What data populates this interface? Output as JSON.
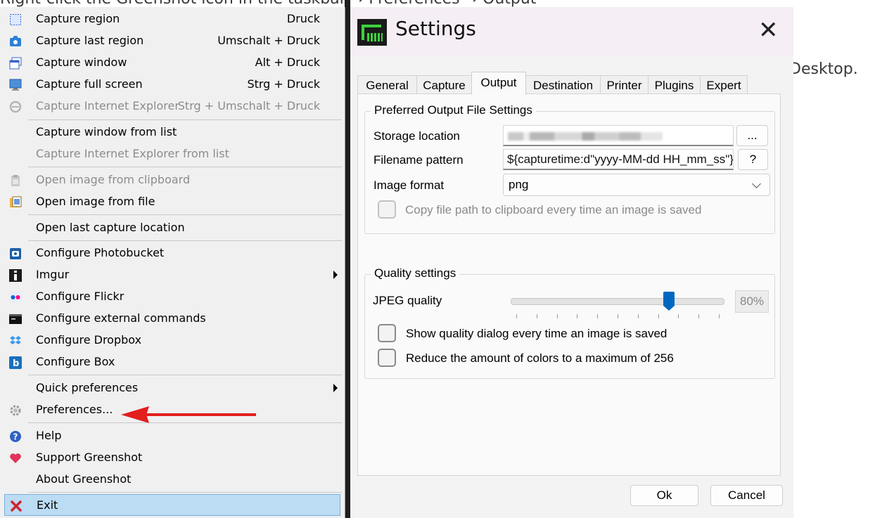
{
  "background": {
    "top_text": "Right-click the Greenshot icon in the taskbar → Preferences → Output",
    "right_text": "Desktop."
  },
  "menu": {
    "items": [
      {
        "icon": "capture-region-icon",
        "label": "Capture region",
        "shortcut": "Druck"
      },
      {
        "icon": "capture-last-region-icon",
        "label": "Capture last region",
        "shortcut": "Umschalt + Druck"
      },
      {
        "icon": "capture-window-icon",
        "label": "Capture window",
        "shortcut": "Alt + Druck"
      },
      {
        "icon": "capture-full-screen-icon",
        "label": "Capture full screen",
        "shortcut": "Strg + Druck"
      },
      {
        "icon": "internet-explorer-icon",
        "label": "Capture Internet Explorer",
        "shortcut": "Strg + Umschalt + Druck"
      },
      {
        "label": "Capture window from list"
      },
      {
        "label": "Capture Internet Explorer from list"
      },
      {
        "icon": "clipboard-icon",
        "label": "Open image from clipboard"
      },
      {
        "icon": "folder-image-icon",
        "label": "Open image from file"
      },
      {
        "label": "Open last capture location"
      },
      {
        "icon": "photobucket-icon",
        "label": "Configure Photobucket"
      },
      {
        "icon": "imgur-icon",
        "label": "Imgur"
      },
      {
        "icon": "flickr-icon",
        "label": "Configure Flickr"
      },
      {
        "icon": "terminal-icon",
        "label": "Configure external commands"
      },
      {
        "icon": "dropbox-icon",
        "label": "Configure Dropbox"
      },
      {
        "icon": "box-icon",
        "label": "Configure Box"
      },
      {
        "label": "Quick preferences"
      },
      {
        "icon": "gear-icon",
        "label": "Preferences..."
      },
      {
        "icon": "help-icon",
        "label": "Help"
      },
      {
        "icon": "heart-icon",
        "label": "Support Greenshot"
      },
      {
        "label": "About Greenshot"
      },
      {
        "icon": "exit-icon",
        "label": "Exit"
      }
    ]
  },
  "settings": {
    "title": "Settings",
    "tabs": [
      "General",
      "Capture",
      "Output",
      "Destination",
      "Printer",
      "Plugins",
      "Expert"
    ],
    "active_tab": "Output",
    "output_group": {
      "title": "Preferred Output File Settings",
      "storage_label": "Storage location",
      "browse_label": "...",
      "filename_label": "Filename pattern",
      "filename_value": "${capturetime:d\"yyyy-MM-dd HH_mm_ss\"}",
      "help_label": "?",
      "format_label": "Image format",
      "format_value": "png",
      "copy_path_label": "Copy file path to clipboard every time an image is saved"
    },
    "quality_group": {
      "title": "Quality settings",
      "jpeg_label": "JPEG quality",
      "jpeg_value": "80%",
      "jpeg_quality": 80,
      "show_dialog_label": "Show quality dialog every time an image is saved",
      "reduce_colors_label": "Reduce the amount of colors to a maximum of 256"
    },
    "ok_label": "Ok",
    "cancel_label": "Cancel"
  },
  "colors": {
    "menu_bg": "#f0f0f0",
    "selection": "#bcdcf4",
    "arrow": "#e31e1e",
    "accent": "#0067c0"
  }
}
